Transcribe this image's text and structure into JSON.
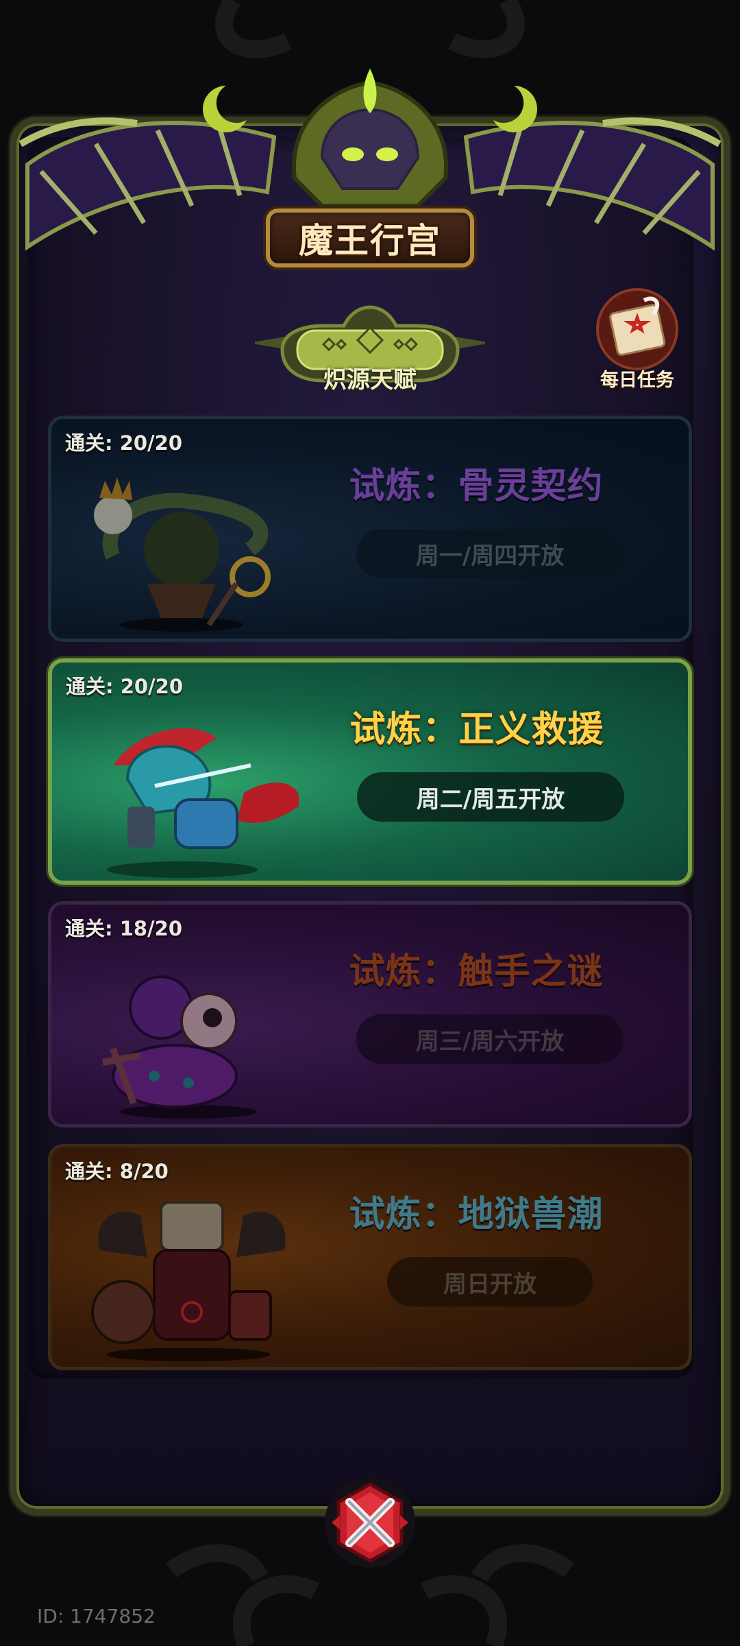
{
  "header": {
    "title": "魔王行宫",
    "talent_label": "炽源天赋",
    "daily_task_label": "每日任务"
  },
  "trials": [
    {
      "clear_label": "通关: 20/20",
      "cleared": 20,
      "total": 20,
      "title": "试炼：骨灵契约",
      "schedule": "周一/周四开放",
      "active": false
    },
    {
      "clear_label": "通关: 20/20",
      "cleared": 20,
      "total": 20,
      "title": "试炼：正义救援",
      "schedule": "周二/周五开放",
      "active": true
    },
    {
      "clear_label": "通关: 18/20",
      "cleared": 18,
      "total": 20,
      "title": "试炼：触手之谜",
      "schedule": "周三/周六开放",
      "active": false
    },
    {
      "clear_label": "通关: 8/20",
      "cleared": 8,
      "total": 20,
      "title": "试炼：地狱兽潮",
      "schedule": "周日开放",
      "active": false
    }
  ],
  "footer": {
    "player_id": "ID: 1747852",
    "close_icon": "crossed-swords-close-icon"
  },
  "colors": {
    "frame_accent": "#7aa24a",
    "active_title": "#ffd24a",
    "title_gold": "#b58a3e"
  }
}
